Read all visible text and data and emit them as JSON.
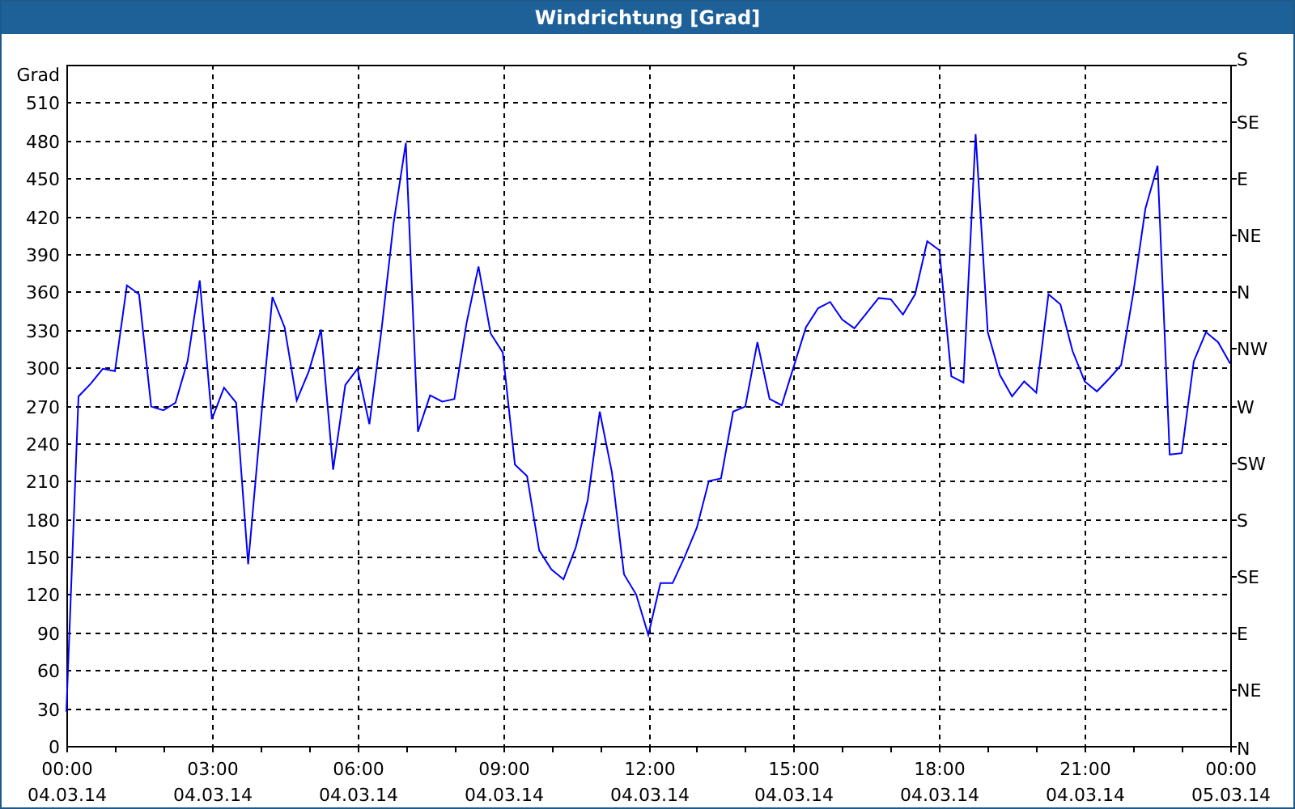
{
  "window": {
    "title": "Windrichtung [Grad]"
  },
  "chart": {
    "right_axis": {
      "labels": [
        "S",
        "SE",
        "E",
        "NE",
        "N",
        "NW",
        "W",
        "SW",
        "S",
        "SE",
        "E",
        "NE",
        "N"
      ]
    },
    "chart_data": {
      "type": "line",
      "grid": true,
      "ylabel": "Grad",
      "ylim": [
        0,
        540
      ],
      "yticks": [
        0,
        30,
        60,
        90,
        120,
        150,
        180,
        210,
        240,
        270,
        300,
        330,
        360,
        390,
        420,
        450,
        480,
        510
      ],
      "categories": [
        "00:00\n04.03.14",
        null,
        null,
        null,
        null,
        null,
        null,
        null,
        null,
        null,
        null,
        null,
        "03:00\n04.03.14",
        null,
        null,
        null,
        null,
        null,
        null,
        null,
        null,
        null,
        null,
        null,
        "06:00\n04.03.14",
        null,
        null,
        null,
        null,
        null,
        null,
        null,
        null,
        null,
        null,
        null,
        "09:00\n04.03.14",
        null,
        null,
        null,
        null,
        null,
        null,
        null,
        null,
        null,
        null,
        null,
        "12:00\n04.03.14",
        null,
        null,
        null,
        null,
        null,
        null,
        null,
        null,
        null,
        null,
        null,
        "15:00\n04.03.14",
        null,
        null,
        null,
        null,
        null,
        null,
        null,
        null,
        null,
        null,
        null,
        "18:00\n04.03.14",
        null,
        null,
        null,
        null,
        null,
        null,
        null,
        null,
        null,
        null,
        null,
        "21:00\n04.03.14",
        null,
        null,
        null,
        null,
        null,
        null,
        null,
        null,
        null,
        null,
        null,
        "00:00\n05.03.14"
      ],
      "series": [
        {
          "color": "#0000ff",
          "values": [
            27,
            277,
            287,
            299,
            297,
            365,
            358,
            269,
            266,
            272,
            305,
            369,
            259,
            284,
            272,
            144,
            253,
            356,
            332,
            274,
            297,
            330,
            219,
            286,
            299,
            255,
            330,
            415,
            478,
            249,
            278,
            273,
            275,
            335,
            380,
            327,
            312,
            223,
            214,
            155,
            140,
            132,
            157,
            195,
            265,
            217,
            136,
            120,
            88,
            129,
            129,
            150,
            173,
            210,
            212,
            265,
            269,
            320,
            275,
            270,
            301,
            332,
            347,
            352,
            338,
            331,
            343,
            355,
            354,
            342,
            358,
            400,
            393,
            293,
            288,
            485,
            328,
            294,
            277,
            289,
            280,
            358,
            350,
            313,
            289,
            281,
            291,
            302,
            359,
            426,
            460,
            231,
            232,
            305,
            328,
            320,
            303
          ]
        }
      ]
    }
  }
}
